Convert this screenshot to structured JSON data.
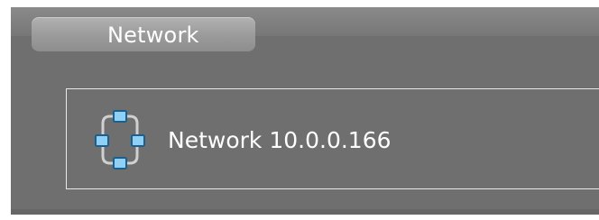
{
  "tab": {
    "label": "Network"
  },
  "network_item": {
    "label": "Network 10.0.0.166",
    "icon": "network-topology-icon"
  },
  "colors": {
    "background": "#6f6f6f",
    "node_fill": "#8fd0f7",
    "node_stroke": "#1b5f8f",
    "text": "#ffffff",
    "panel_border": "#e9e9e9"
  }
}
